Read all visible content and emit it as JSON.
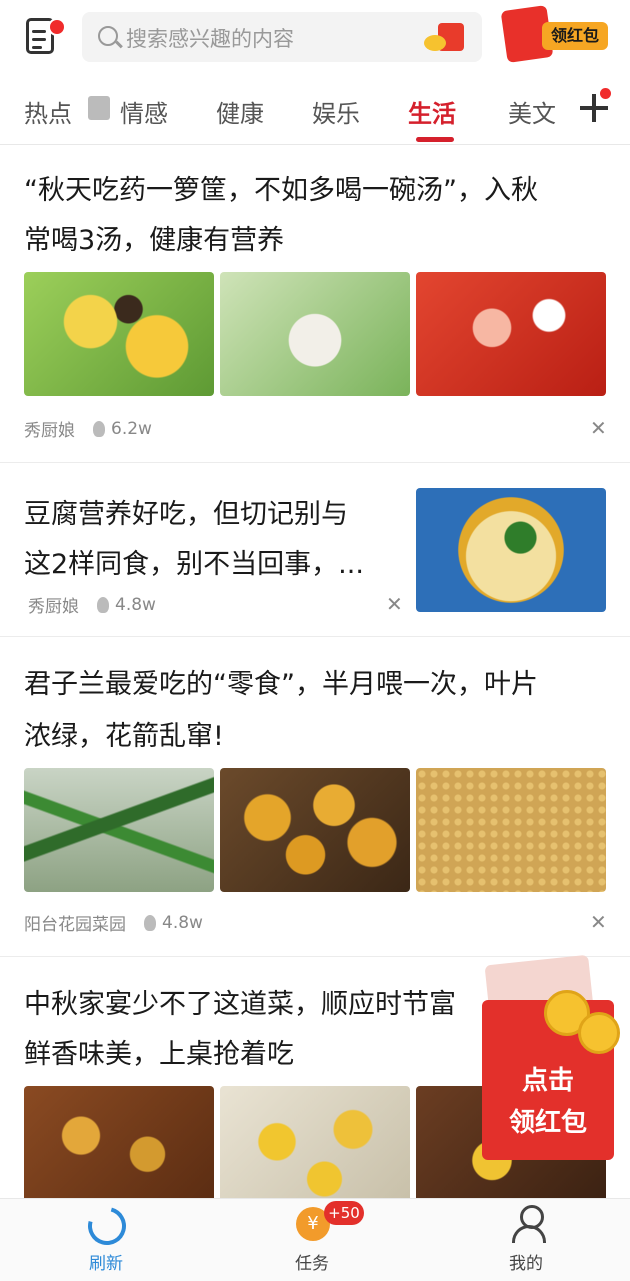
{
  "search": {
    "placeholder": "搜索感兴趣的内容"
  },
  "header": {
    "redpack_label": "领红包"
  },
  "tabs": [
    {
      "label": "热点"
    },
    {
      "label": "情感"
    },
    {
      "label": "健康"
    },
    {
      "label": "娱乐"
    },
    {
      "label": "生活",
      "active": true
    },
    {
      "label": "美文"
    }
  ],
  "feed": [
    {
      "title_line1": "“秋天吃药一箩筐，不如多喝一碗汤”，入秋",
      "title_line2": "常喝3汤，健康有营养",
      "source": "秀厨娘",
      "heat": "6.2w"
    },
    {
      "title_line1": "豆腐营养好吃，但切记别与",
      "title_line2": "这2样同食，别不当回事，...",
      "source": "秀厨娘",
      "heat": "4.8w"
    },
    {
      "title_line1": "君子兰最爱吃的“零食”，半月喂一次，叶片",
      "title_line2": "浓绿，花箭乱窜!",
      "source": "阳台花园菜园",
      "heat": "4.8w"
    },
    {
      "title_line1": "中秋家宴少不了这道菜，顺应时节富",
      "title_line2": "鲜香味美，上桌抢着吃"
    }
  ],
  "float_packet": {
    "line1": "点击",
    "line2": "领红包"
  },
  "bottom_nav": [
    {
      "label": "刷新",
      "active": true
    },
    {
      "label": "任务",
      "badge": "+50"
    },
    {
      "label": "我的"
    }
  ],
  "colors": {
    "accent": "#d5202c",
    "active_blue": "#2d8ad8"
  }
}
